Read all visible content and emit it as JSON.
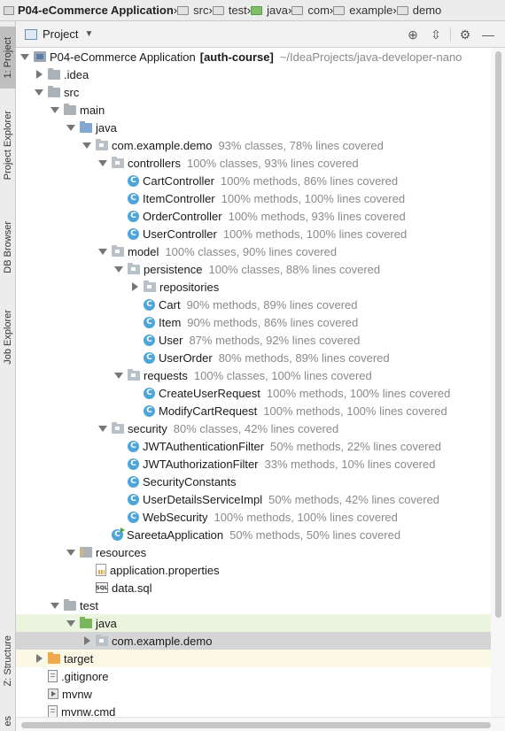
{
  "breadcrumb": {
    "project": "P04-eCommerce Application",
    "items": [
      "src",
      "test",
      "java",
      "com",
      "example",
      "demo"
    ]
  },
  "toolstrip": {
    "tabs": [
      "1: Project",
      "Project Explorer",
      "DB Browser",
      "Job Explorer",
      "Z: Structure",
      "es"
    ]
  },
  "panel": {
    "title": "Project",
    "tool_icons": [
      "locate-icon",
      "collapse-icon",
      "gear-icon",
      "hide-icon"
    ]
  },
  "tree": {
    "root_name": "P04-eCommerce Application",
    "root_branch": "[auth-course]",
    "root_path": "~/IdeaProjects/java-developer-nano",
    "idea": ".idea",
    "src": "src",
    "main": "main",
    "java": "java",
    "demo_pkg": "com.example.demo",
    "demo_cov": "93% classes, 78% lines covered",
    "controllers": "controllers",
    "controllers_cov": "100% classes, 93% lines covered",
    "cart_controller": "CartController",
    "cart_controller_cov": "100% methods, 86% lines covered",
    "item_controller": "ItemController",
    "item_controller_cov": "100% methods, 100% lines covered",
    "order_controller": "OrderController",
    "order_controller_cov": "100% methods, 93% lines covered",
    "user_controller": "UserController",
    "user_controller_cov": "100% methods, 100% lines covered",
    "model": "model",
    "model_cov": "100% classes, 90% lines covered",
    "persistence": "persistence",
    "persistence_cov": "100% classes, 88% lines covered",
    "repositories": "repositories",
    "cart": "Cart",
    "cart_cov": "90% methods, 89% lines covered",
    "item": "Item",
    "item_cov": "90% methods, 86% lines covered",
    "user": "User",
    "user_cov": "87% methods, 92% lines covered",
    "user_order": "UserOrder",
    "user_order_cov": "80% methods, 89% lines covered",
    "requests": "requests",
    "requests_cov": "100% classes, 100% lines covered",
    "create_user_request": "CreateUserRequest",
    "create_user_request_cov": "100% methods, 100% lines covered",
    "modify_cart_request": "ModifyCartRequest",
    "modify_cart_request_cov": "100% methods, 100% lines covered",
    "security": "security",
    "security_cov": "80% classes, 42% lines covered",
    "jwt_auth_filter": "JWTAuthenticationFilter",
    "jwt_auth_filter_cov": "50% methods, 22% lines covered",
    "jwt_authz_filter": "JWTAuthorizationFilter",
    "jwt_authz_filter_cov": "33% methods, 10% lines covered",
    "security_constants": "SecurityConstants",
    "user_details_service": "UserDetailsServiceImpl",
    "user_details_service_cov": "50% methods, 42% lines covered",
    "web_security": "WebSecurity",
    "web_security_cov": "100% methods, 100% lines covered",
    "sareeta_app": "SareetaApplication",
    "sareeta_app_cov": "50% methods, 50% lines covered",
    "resources": "resources",
    "app_properties": "application.properties",
    "data_sql": "data.sql",
    "test": "test",
    "test_java": "java",
    "test_demo_pkg": "com.example.demo",
    "target": "target",
    "gitignore": ".gitignore",
    "mvnw": "mvnw",
    "mvnw_cmd": "mvnw.cmd"
  },
  "colors": {
    "selected_row": "#eaf4de",
    "highlighted_row": "#d5d5d5",
    "class_icon": "#4ea5d8",
    "coverage_text": "#8a8a8a"
  }
}
